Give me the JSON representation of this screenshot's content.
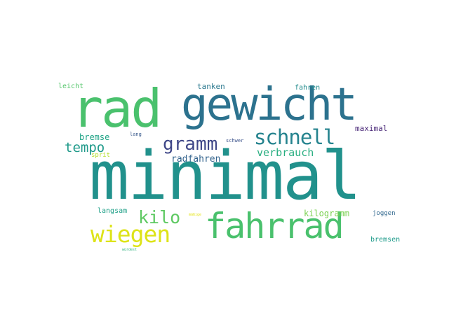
{
  "word_cloud": {
    "words": {
      "minimal": "minimal",
      "rad": "rad",
      "gewicht": "gewicht",
      "fahrrad": "fahrrad",
      "schnell": "schnell",
      "wiegen": "wiegen",
      "gramm": "gramm",
      "kilo": "kilo",
      "tempo": "tempo",
      "verbrauch": "verbrauch",
      "radfahren": "radfahren",
      "bremse": "bremse",
      "maximal": "maximal",
      "tanken": "tanken",
      "fahren": "fahren",
      "leicht": "leicht",
      "kilogramm": "kilogramm",
      "langsam": "langsam",
      "joggen": "joggen",
      "bremsen": "bremsen",
      "sprit": "sprit",
      "schwer": "schwer",
      "lang": "lang",
      "maessig": "mäßige",
      "wuerdest": "würdest"
    },
    "colors": {
      "palette": "viridis",
      "background": "#ffffff"
    }
  }
}
